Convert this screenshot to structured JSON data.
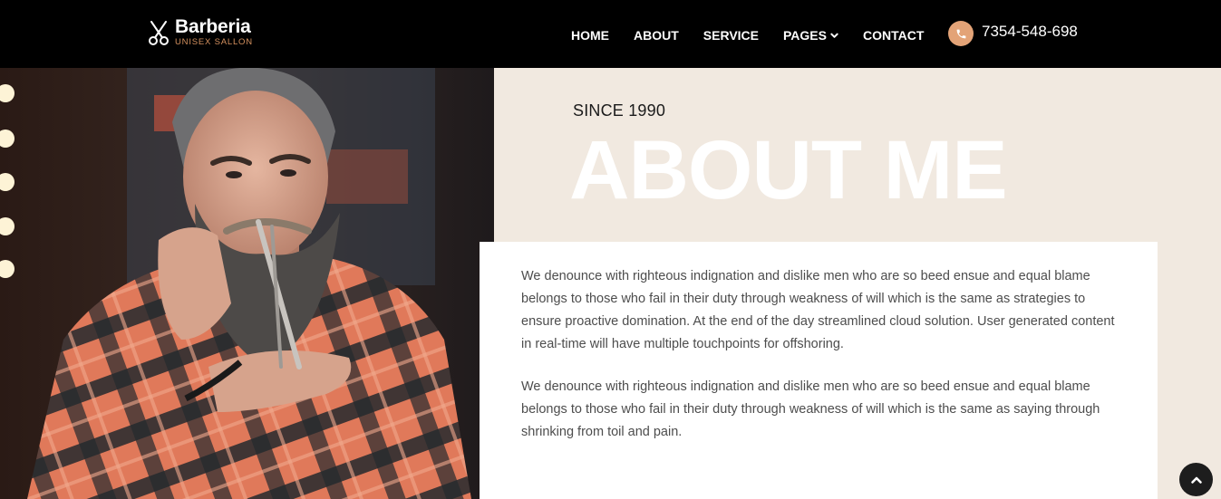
{
  "brand": {
    "name": "Barberia",
    "tagline": "UNISEX SALLON",
    "accent_color": "#d5915f",
    "icon": "scissors-icon"
  },
  "nav": {
    "items": [
      {
        "label": "HOME"
      },
      {
        "label": "ABOUT"
      },
      {
        "label": "SERVICE"
      },
      {
        "label": "PAGES"
      },
      {
        "label": "CONTACT"
      }
    ]
  },
  "contact": {
    "phone": "7354-548-698",
    "icon": "phone-icon",
    "icon_bg": "#e3a377"
  },
  "hero": {
    "since": "SINCE 1990",
    "title": "ABOUT ME"
  },
  "content": {
    "paragraph_1": "We denounce with righteous indignation and dislike men who are so beed ensue and equal blame belongs to those who fail in their duty through weakness of will which is the same as strategies to ensure proactive domination. At the end of the day streamlined cloud solution. User generated content in real-time will have multiple touchpoints for offshoring.",
    "paragraph_2": "We denounce with righteous indignation and dislike men who are so beed ensue and equal blame belongs to those who fail in their duty through weakness of will which is the same as saying through shrinking from toil and pain."
  },
  "colors": {
    "header_bg": "#000000",
    "page_bg": "#f1e9e0",
    "card_bg": "#ffffff"
  }
}
